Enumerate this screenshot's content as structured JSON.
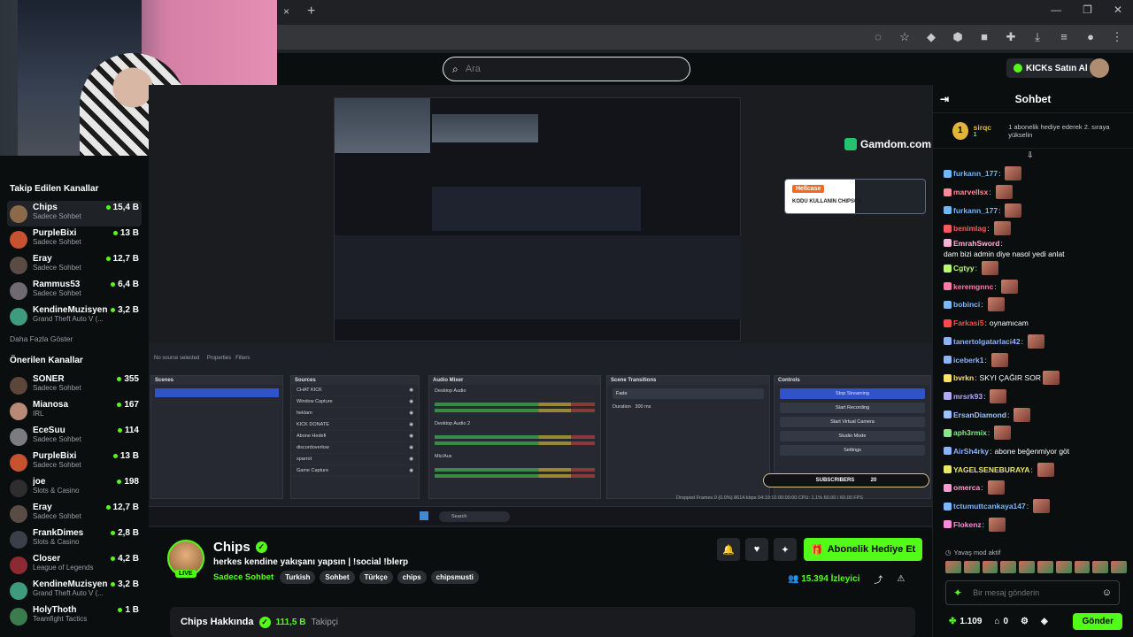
{
  "browser": {
    "tab_close": "×",
    "tab_new": "+",
    "win_min": "—",
    "win_max": "❐",
    "win_close": "✕"
  },
  "header": {
    "search_placeholder": "Ara",
    "kicks_button": "KICKs Satın Al"
  },
  "sidebar": {
    "following_title": "Takip Edilen Kanallar",
    "following": [
      {
        "name": "Chips",
        "category": "Sadece Sohbet",
        "viewers": "15,4 B",
        "color": "#8a6a4a"
      },
      {
        "name": "PurpleBixi",
        "category": "Sadece Sohbet",
        "viewers": "13 B",
        "color": "#c6522f"
      },
      {
        "name": "Eray",
        "category": "Sadece Sohbet",
        "viewers": "12,7 B",
        "color": "#5b4b45"
      },
      {
        "name": "Rammus53",
        "category": "Sadece Sohbet",
        "viewers": "6,4 B",
        "color": "#6f6a72"
      },
      {
        "name": "KendineMuzisyen",
        "category": "Grand Theft Auto V (...",
        "viewers": "3,2 B",
        "color": "#3e9b7d"
      }
    ],
    "show_more": "Daha Fazla Göster",
    "recommended_title": "Önerilen Kanallar",
    "recommended": [
      {
        "name": "SONER",
        "category": "Sadece Sohbet",
        "viewers": "355",
        "color": "#5c4539"
      },
      {
        "name": "Mianosa",
        "category": "IRL",
        "viewers": "167",
        "color": "#b78a77"
      },
      {
        "name": "EceSuu",
        "category": "Sadece Sohbet",
        "viewers": "114",
        "color": "#7b7b80"
      },
      {
        "name": "PurpleBixi",
        "category": "Sadece Sohbet",
        "viewers": "13 B",
        "color": "#c6522f"
      },
      {
        "name": "joe",
        "category": "Slots & Casino",
        "viewers": "198",
        "color": "#2e2e2e"
      },
      {
        "name": "Eray",
        "category": "Sadece Sohbet",
        "viewers": "12,7 B",
        "color": "#5b4b45"
      },
      {
        "name": "FrankDimes",
        "category": "Slots & Casino",
        "viewers": "2,8 B",
        "color": "#3a3f4a"
      },
      {
        "name": "Closer",
        "category": "League of Legends",
        "viewers": "4,2 B",
        "color": "#8c2a34"
      },
      {
        "name": "KendineMuzisyen",
        "category": "Grand Theft Auto V (...",
        "viewers": "3,2 B",
        "color": "#3e9b7d"
      },
      {
        "name": "HolyThoth",
        "category": "Teamfight Tactics",
        "viewers": "1 B",
        "color": "#3a7c4d"
      }
    ]
  },
  "player": {
    "gamdom": "Gamdom.com",
    "hellcase": "Hellcase",
    "hellcase_code": "KODU KULLANIN CHIPSCS",
    "obs_no_source": "No source selected",
    "obs_properties": "Properties",
    "obs_filters": "Filters",
    "panels": {
      "scenes": "Scenes",
      "sources": "Sources",
      "mixer": "Audio Mixer",
      "transitions": "Scene Transitions",
      "controls": "Controls"
    },
    "sources_list": [
      "CHAT KICK",
      "Window Capture",
      "heklam",
      "KICK DONATE",
      "Abone Hedefi",
      "discordoverlow",
      "xparrot",
      "Game Capture"
    ],
    "mixer_tracks": [
      "Desktop Audio",
      "Desktop Audio 2",
      "Mic/Aux"
    ],
    "transition_fade": "Fade",
    "transition_duration_label": "Duration",
    "transition_duration": "300 ms",
    "controls_list": [
      "Stop Streaming",
      "Start Recording",
      "Start Virtual Camera",
      "Studio Mode",
      "Settings"
    ],
    "subscribers_label": "SUBSCRIBERS",
    "subscribers_count": "20",
    "status_text": "Dropped Frames 0 (0.0%)   8614 kbps   04:19:10   00:00:00   CPU: 1.1%   60.00 / 60.00 FPS",
    "taskbar_search": "Search"
  },
  "channel": {
    "name": "Chips",
    "live": "LIVE",
    "title": "herkes kendine yakışanı yapsın | !social !blerp",
    "category": "Sadece Sohbet",
    "tags": [
      "Turkish",
      "Sohbet",
      "Türkçe",
      "chips",
      "chipsmusti"
    ],
    "gift_button": "Abonelik Hediye Et",
    "viewers": "15.394",
    "viewers_label": "İzleyici",
    "about": "Chips Hakkında",
    "followers": "111,5 B",
    "followers_label": "Takipçi"
  },
  "chat": {
    "title": "Sohbet",
    "pinned_rank": "1",
    "pinned_user": "sirqc",
    "pinned_count": "1",
    "pinned_text": "1 abonelik hediye ederek 2. sıraya yükselin",
    "messages": [
      {
        "user": "furkann_177",
        "color": "#6fb8ff",
        "text": "",
        "emote": true
      },
      {
        "user": "marvellsx",
        "color": "#ff8a9a",
        "text": "",
        "emote": true
      },
      {
        "user": "furkann_177",
        "color": "#6fb8ff",
        "text": "",
        "emote": true
      },
      {
        "user": "benimlag",
        "color": "#ff5a5a",
        "text": "",
        "emote": true
      },
      {
        "user": "EmrahSword",
        "color": "#ffb0d8",
        "text": "dam bizi admin diye nasol yedi anlat",
        "emote": false
      },
      {
        "user": "Cgtyy",
        "color": "#b9ff6a",
        "text": "",
        "emote": true
      },
      {
        "user": "keremgnnc",
        "color": "#ff7aa8",
        "text": "",
        "emote": true
      },
      {
        "user": "bobinci",
        "color": "#7ab8ff",
        "text": "",
        "emote": true
      },
      {
        "user": "Farkasi5",
        "color": "#ff4a4a",
        "text": "oynamıcam",
        "emote": false
      },
      {
        "user": "tanertolgatarlaci42",
        "color": "#8ab4ff",
        "text": "",
        "emote": true
      },
      {
        "user": "iceberk1",
        "color": "#8ab4ff",
        "text": "",
        "emote": true
      },
      {
        "user": "bvrkn",
        "color": "#ffe06a",
        "text": "SKYI ÇAĞIR SOR",
        "emote": true
      },
      {
        "user": "mrsrk93",
        "color": "#b6a6ff",
        "text": "",
        "emote": true
      },
      {
        "user": "ErsanDiamond",
        "color": "#9ac3ff",
        "text": "",
        "emote": true
      },
      {
        "user": "aph3rmix",
        "color": "#8ae68a",
        "text": "",
        "emote": true
      },
      {
        "user": "AirSh4rky",
        "color": "#8ab4ff",
        "text": "abone beğenmiyor göt",
        "emote": false
      },
      {
        "user": "YAGELSENEBURAYA",
        "color": "#e8e86a",
        "text": "",
        "emote": true
      },
      {
        "user": "omerca",
        "color": "#ff9ad0",
        "text": "",
        "emote": true
      },
      {
        "user": "tctumuttcankaya147",
        "color": "#7ab8ff",
        "text": "",
        "emote": true
      },
      {
        "user": "Flokenz",
        "color": "#ff8ad8",
        "text": "",
        "emote": true
      }
    ],
    "slow_mode": "Yavaş mod aktif",
    "input_placeholder": "Bir mesaj gönderin",
    "kicks_count": "1.109",
    "gift_count": "0",
    "send_button": "Gönder"
  }
}
